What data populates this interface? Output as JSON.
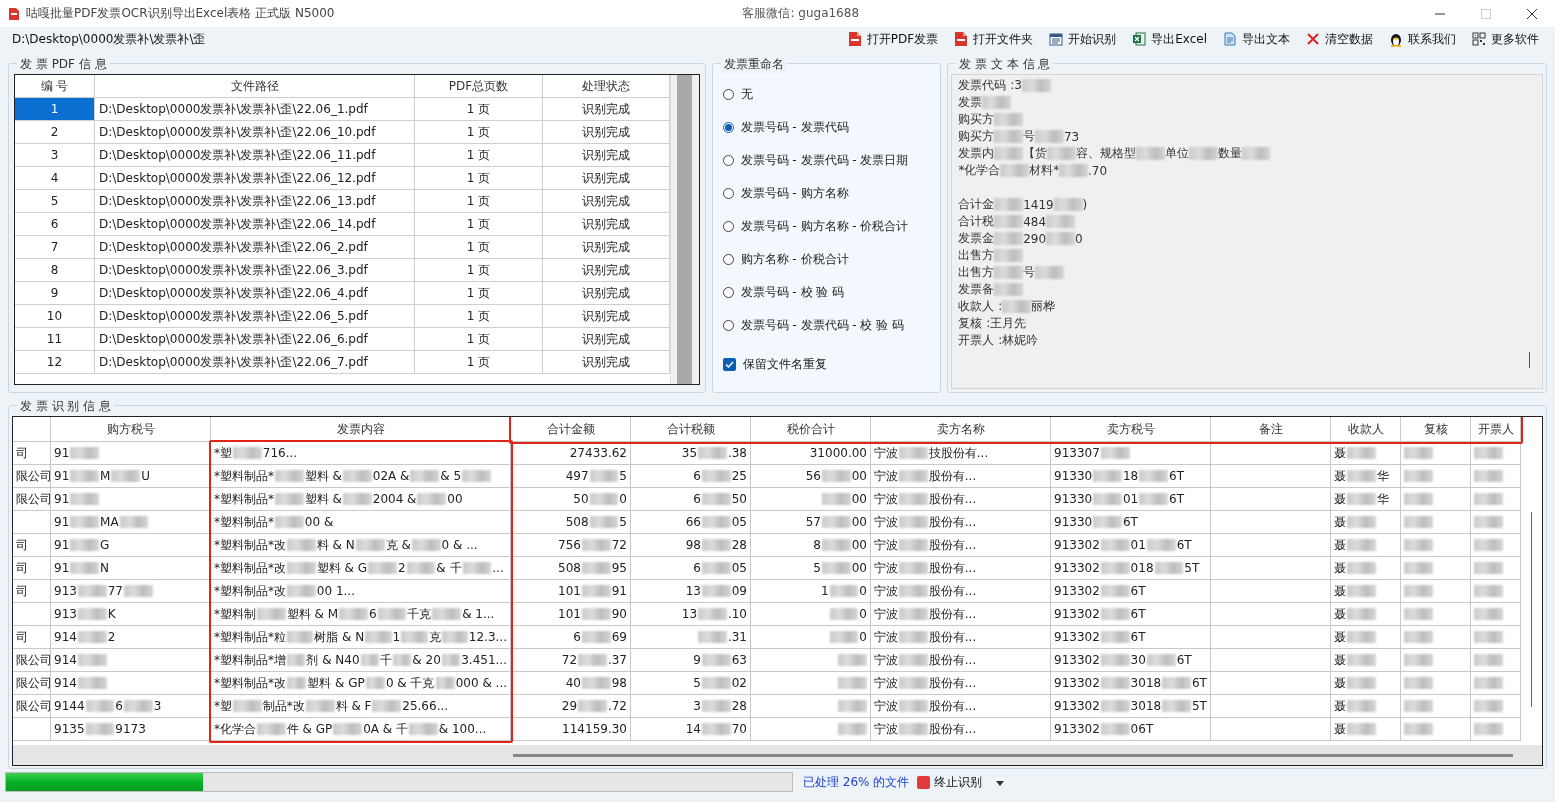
{
  "window": {
    "title": "咕嘎批量PDF发票OCR识别导出Excel表格  正式版 N5000",
    "contact": "客服微信: guga1688"
  },
  "path_field": {
    "value": "D:\\Desktop\\0000发票补\\发票补\\歪"
  },
  "toolbar": [
    {
      "label": "打开PDF发票"
    },
    {
      "label": "打开文件夹"
    },
    {
      "label": "开始识别"
    },
    {
      "label": "导出Excel"
    },
    {
      "label": "导出文本"
    },
    {
      "label": "清空数据"
    },
    {
      "label": "联系我们"
    },
    {
      "label": "更多软件"
    }
  ],
  "pdf_info": {
    "title": "发 票 PDF 信 息",
    "columns": [
      "编 号",
      "文件路径",
      "PDF总页数",
      "处理状态"
    ],
    "rows": [
      {
        "selected": true,
        "cells": [
          "1",
          "D:\\Desktop\\0000发票补\\发票补\\歪\\22.06_1.pdf",
          "1 页",
          "识别完成"
        ]
      },
      {
        "selected": false,
        "cells": [
          "2",
          "D:\\Desktop\\0000发票补\\发票补\\歪\\22.06_10.pdf",
          "1 页",
          "识别完成"
        ]
      },
      {
        "selected": false,
        "cells": [
          "3",
          "D:\\Desktop\\0000发票补\\发票补\\歪\\22.06_11.pdf",
          "1 页",
          "识别完成"
        ]
      },
      {
        "selected": false,
        "cells": [
          "4",
          "D:\\Desktop\\0000发票补\\发票补\\歪\\22.06_12.pdf",
          "1 页",
          "识别完成"
        ]
      },
      {
        "selected": false,
        "cells": [
          "5",
          "D:\\Desktop\\0000发票补\\发票补\\歪\\22.06_13.pdf",
          "1 页",
          "识别完成"
        ]
      },
      {
        "selected": false,
        "cells": [
          "6",
          "D:\\Desktop\\0000发票补\\发票补\\歪\\22.06_14.pdf",
          "1 页",
          "识别完成"
        ]
      },
      {
        "selected": false,
        "cells": [
          "7",
          "D:\\Desktop\\0000发票补\\发票补\\歪\\22.06_2.pdf",
          "1 页",
          "识别完成"
        ]
      },
      {
        "selected": false,
        "cells": [
          "8",
          "D:\\Desktop\\0000发票补\\发票补\\歪\\22.06_3.pdf",
          "1 页",
          "识别完成"
        ]
      },
      {
        "selected": false,
        "cells": [
          "9",
          "D:\\Desktop\\0000发票补\\发票补\\歪\\22.06_4.pdf",
          "1 页",
          "识别完成"
        ]
      },
      {
        "selected": false,
        "cells": [
          "10",
          "D:\\Desktop\\0000发票补\\发票补\\歪\\22.06_5.pdf",
          "1 页",
          "识别完成"
        ]
      },
      {
        "selected": false,
        "cells": [
          "11",
          "D:\\Desktop\\0000发票补\\发票补\\歪\\22.06_6.pdf",
          "1 页",
          "识别完成"
        ]
      },
      {
        "selected": false,
        "cells": [
          "12",
          "D:\\Desktop\\0000发票补\\发票补\\歪\\22.06_7.pdf",
          "1 页",
          "识别完成"
        ]
      }
    ]
  },
  "rename": {
    "title": "发票重命名",
    "options": [
      {
        "label": "无",
        "selected": false
      },
      {
        "label": "发票号码 - 发票代码",
        "selected": true
      },
      {
        "label": "发票号码 - 发票代码 - 发票日期",
        "selected": false
      },
      {
        "label": "发票号码 - 购方名称",
        "selected": false
      },
      {
        "label": "发票号码 - 购方名称 - 价税合计",
        "selected": false
      },
      {
        "label": "购方名称 - 价税合计",
        "selected": false
      },
      {
        "label": "发票号码 - 校 验 码",
        "selected": false
      },
      {
        "label": "发票号码 - 发票代码 - 校 验 码",
        "selected": false
      }
    ],
    "keep_duplicates": {
      "label": "保留文件名重复",
      "checked": true
    }
  },
  "text_info": {
    "title": "发 票 文 本 信 息",
    "lines": [
      {
        "kind": "text",
        "parts": [
          {
            "kind": "text",
            "text": "发票代码 :3"
          },
          {
            "kind": "blur"
          }
        ]
      },
      {
        "kind": "text",
        "parts": [
          {
            "kind": "text",
            "text": "发票"
          },
          {
            "kind": "blur"
          }
        ]
      },
      {
        "kind": "text",
        "parts": [
          {
            "kind": "text",
            "text": "购买方"
          },
          {
            "kind": "blur"
          }
        ]
      },
      {
        "kind": "text",
        "parts": [
          {
            "kind": "text",
            "text": "购买方"
          },
          {
            "kind": "blur"
          },
          {
            "kind": "text",
            "text": "号"
          },
          {
            "kind": "blur"
          },
          {
            "kind": "text",
            "text": "73"
          }
        ]
      },
      {
        "kind": "text",
        "parts": [
          {
            "kind": "text",
            "text": "发票内"
          },
          {
            "kind": "blur"
          },
          {
            "kind": "text",
            "text": "【货"
          },
          {
            "kind": "blur"
          },
          {
            "kind": "text",
            "text": "容、规格型"
          },
          {
            "kind": "blur"
          },
          {
            "kind": "text",
            "text": "单位"
          },
          {
            "kind": "blur"
          },
          {
            "kind": "text",
            "text": "数量"
          },
          {
            "kind": "blur"
          }
        ]
      },
      {
        "kind": "text",
        "parts": [
          {
            "kind": "text",
            "text": "*化学合"
          },
          {
            "kind": "blur"
          },
          {
            "kind": "text",
            "text": "材料*"
          },
          {
            "kind": "blur"
          },
          {
            "kind": "text",
            "text": ".70"
          }
        ]
      },
      {
        "kind": "blank"
      },
      {
        "kind": "text",
        "parts": [
          {
            "kind": "text",
            "text": "合计金"
          },
          {
            "kind": "blur"
          },
          {
            "kind": "text",
            "text": "1419"
          },
          {
            "kind": "blur"
          },
          {
            "kind": "text",
            "text": ")"
          }
        ]
      },
      {
        "kind": "text",
        "parts": [
          {
            "kind": "text",
            "text": "合计税"
          },
          {
            "kind": "blur"
          },
          {
            "kind": "text",
            "text": "484"
          },
          {
            "kind": "blur"
          }
        ]
      },
      {
        "kind": "text",
        "parts": [
          {
            "kind": "text",
            "text": "发票金"
          },
          {
            "kind": "blur"
          },
          {
            "kind": "text",
            "text": "290"
          },
          {
            "kind": "blur"
          },
          {
            "kind": "text",
            "text": "0"
          }
        ]
      },
      {
        "kind": "text",
        "parts": [
          {
            "kind": "text",
            "text": "出售方"
          },
          {
            "kind": "blur"
          }
        ]
      },
      {
        "kind": "text",
        "parts": [
          {
            "kind": "text",
            "text": "出售方"
          },
          {
            "kind": "blur"
          },
          {
            "kind": "text",
            "text": "号"
          },
          {
            "kind": "blur"
          }
        ]
      },
      {
        "kind": "text",
        "parts": [
          {
            "kind": "text",
            "text": "发票备"
          },
          {
            "kind": "blur"
          }
        ]
      },
      {
        "kind": "text",
        "parts": [
          {
            "kind": "text",
            "text": "收款人 :"
          },
          {
            "kind": "blur"
          },
          {
            "kind": "text",
            "text": "丽桦"
          }
        ]
      },
      {
        "kind": "text",
        "parts": [
          {
            "kind": "text",
            "text": "复核 :王月先"
          }
        ]
      },
      {
        "kind": "text",
        "parts": [
          {
            "kind": "text",
            "text": "开票人 :林妮吟"
          }
        ]
      }
    ]
  },
  "results": {
    "title": "发 票 识 别 信 息",
    "columns": [
      {
        "header_marked": false,
        "body_marked": false
      },
      {
        "label": "购方税号",
        "header_marked": false,
        "body_marked": false
      },
      {
        "label": "发票内容",
        "header_marked": false,
        "body_marked": true
      },
      {
        "label": "合计金额",
        "header_marked": true,
        "body_marked": false
      },
      {
        "label": "合计税额",
        "header_marked": true,
        "body_marked": false
      },
      {
        "label": "税价合计",
        "header_marked": true,
        "body_marked": false
      },
      {
        "label": "卖方名称",
        "header_marked": true,
        "body_marked": false
      },
      {
        "label": "卖方税号",
        "header_marked": true,
        "body_marked": false
      },
      {
        "label": "备注",
        "header_marked": true,
        "body_marked": false
      },
      {
        "label": "收款人",
        "header_marked": true,
        "body_marked": false
      },
      {
        "label": "复核",
        "header_marked": true,
        "body_marked": false
      },
      {
        "label": "开票人",
        "header_marked": true,
        "body_marked": false
      }
    ],
    "rows": [
      [
        [
          {
            "kind": "text",
            "text": "司"
          }
        ],
        [
          {
            "kind": "text",
            "text": "91"
          },
          {
            "kind": "blur"
          }
        ],
        [
          {
            "kind": "text",
            "text": "*塑"
          },
          {
            "kind": "blur"
          },
          {
            "kind": "text",
            "text": "716..."
          }
        ],
        [
          {
            "kind": "text",
            "text": "27433.62"
          }
        ],
        [
          {
            "kind": "text",
            "text": "35"
          },
          {
            "kind": "blur"
          },
          {
            "kind": "text",
            "text": ".38"
          }
        ],
        [
          {
            "kind": "text",
            "text": "31000.00"
          }
        ],
        [
          {
            "kind": "text",
            "text": "宁波"
          },
          {
            "kind": "blur"
          },
          {
            "kind": "text",
            "text": "技股份有..."
          }
        ],
        [
          {
            "kind": "text",
            "text": "913307"
          },
          {
            "kind": "blur"
          }
        ],
        "",
        [
          {
            "kind": "text",
            "text": "聂"
          },
          {
            "kind": "blur"
          }
        ],
        [
          {
            "kind": "blur"
          }
        ],
        [
          {
            "kind": "blur"
          }
        ]
      ],
      [
        [
          {
            "kind": "text",
            "text": "限公司"
          }
        ],
        [
          {
            "kind": "text",
            "text": "91"
          },
          {
            "kind": "blur"
          },
          {
            "kind": "text",
            "text": "M"
          },
          {
            "kind": "blur"
          },
          {
            "kind": "text",
            "text": "U"
          }
        ],
        [
          {
            "kind": "text",
            "text": "*塑料制品*"
          },
          {
            "kind": "blur"
          },
          {
            "kind": "text",
            "text": "塑料 & "
          },
          {
            "kind": "blur"
          },
          {
            "kind": "text",
            "text": "02A & "
          },
          {
            "kind": "blur"
          },
          {
            "kind": "text",
            "text": " & 5"
          },
          {
            "kind": "blur"
          }
        ],
        [
          {
            "kind": "text",
            "text": "497"
          },
          {
            "kind": "blur"
          },
          {
            "kind": "text",
            "text": "5"
          }
        ],
        [
          {
            "kind": "text",
            "text": "6"
          },
          {
            "kind": "blur"
          },
          {
            "kind": "text",
            "text": "25"
          }
        ],
        [
          {
            "kind": "text",
            "text": "56"
          },
          {
            "kind": "blur"
          },
          {
            "kind": "text",
            "text": "00"
          }
        ],
        [
          {
            "kind": "text",
            "text": "宁波"
          },
          {
            "kind": "blur"
          },
          {
            "kind": "text",
            "text": "股份有..."
          }
        ],
        [
          {
            "kind": "text",
            "text": "91330"
          },
          {
            "kind": "blur"
          },
          {
            "kind": "text",
            "text": "18"
          },
          {
            "kind": "blur"
          },
          {
            "kind": "text",
            "text": "6T"
          }
        ],
        "",
        [
          {
            "kind": "text",
            "text": "聂"
          },
          {
            "kind": "blur"
          },
          {
            "kind": "text",
            "text": "华"
          }
        ],
        [
          {
            "kind": "blur"
          }
        ],
        [
          {
            "kind": "blur"
          }
        ]
      ],
      [
        [
          {
            "kind": "text",
            "text": "限公司"
          }
        ],
        [
          {
            "kind": "text",
            "text": "91"
          },
          {
            "kind": "blur"
          }
        ],
        [
          {
            "kind": "text",
            "text": "*塑料制品*"
          },
          {
            "kind": "blur"
          },
          {
            "kind": "text",
            "text": "塑料 & "
          },
          {
            "kind": "blur"
          },
          {
            "kind": "text",
            "text": "2004 & "
          },
          {
            "kind": "blur"
          },
          {
            "kind": "text",
            "text": "00"
          }
        ],
        [
          {
            "kind": "text",
            "text": "50"
          },
          {
            "kind": "blur"
          },
          {
            "kind": "text",
            "text": "0"
          }
        ],
        [
          {
            "kind": "text",
            "text": "6"
          },
          {
            "kind": "blur"
          },
          {
            "kind": "text",
            "text": "50"
          }
        ],
        [
          {
            "kind": "blur"
          },
          {
            "kind": "text",
            "text": "00"
          }
        ],
        [
          {
            "kind": "text",
            "text": "宁波"
          },
          {
            "kind": "blur"
          },
          {
            "kind": "text",
            "text": "股份有..."
          }
        ],
        [
          {
            "kind": "text",
            "text": "91330"
          },
          {
            "kind": "blur"
          },
          {
            "kind": "text",
            "text": "01"
          },
          {
            "kind": "blur"
          },
          {
            "kind": "text",
            "text": "6T"
          }
        ],
        "",
        [
          {
            "kind": "text",
            "text": "聂"
          },
          {
            "kind": "blur"
          },
          {
            "kind": "text",
            "text": "华"
          }
        ],
        [
          {
            "kind": "blur"
          }
        ],
        [
          {
            "kind": "blur"
          }
        ]
      ],
      [
        "",
        [
          {
            "kind": "text",
            "text": "91"
          },
          {
            "kind": "blur"
          },
          {
            "kind": "text",
            "text": "MA"
          },
          {
            "kind": "blur"
          }
        ],
        [
          {
            "kind": "text",
            "text": "*塑料制品*"
          },
          {
            "kind": "blur"
          },
          {
            "kind": "text",
            "text": "00 &"
          }
        ],
        [
          {
            "kind": "text",
            "text": "508"
          },
          {
            "kind": "blur"
          },
          {
            "kind": "text",
            "text": "5"
          }
        ],
        [
          {
            "kind": "text",
            "text": "66"
          },
          {
            "kind": "blur"
          },
          {
            "kind": "text",
            "text": "05"
          }
        ],
        [
          {
            "kind": "text",
            "text": "57"
          },
          {
            "kind": "blur"
          },
          {
            "kind": "text",
            "text": "00"
          }
        ],
        [
          {
            "kind": "text",
            "text": "宁波"
          },
          {
            "kind": "blur"
          },
          {
            "kind": "text",
            "text": "股份有..."
          }
        ],
        [
          {
            "kind": "text",
            "text": "91330"
          },
          {
            "kind": "blur"
          },
          {
            "kind": "text",
            "text": "6T"
          }
        ],
        "",
        [
          {
            "kind": "text",
            "text": "聂"
          },
          {
            "kind": "blur"
          }
        ],
        [
          {
            "kind": "blur"
          }
        ],
        [
          {
            "kind": "blur"
          }
        ]
      ],
      [
        [
          {
            "kind": "text",
            "text": "司"
          }
        ],
        [
          {
            "kind": "text",
            "text": "91"
          },
          {
            "kind": "blur"
          },
          {
            "kind": "text",
            "text": "G"
          }
        ],
        [
          {
            "kind": "text",
            "text": "*塑料制品*改"
          },
          {
            "kind": "blur"
          },
          {
            "kind": "text",
            "text": "料 & N"
          },
          {
            "kind": "blur"
          },
          {
            "kind": "text",
            "text": "克 & "
          },
          {
            "kind": "blur"
          },
          {
            "kind": "text",
            "text": "0 & ..."
          }
        ],
        [
          {
            "kind": "text",
            "text": "756"
          },
          {
            "kind": "blur"
          },
          {
            "kind": "text",
            "text": "72"
          }
        ],
        [
          {
            "kind": "text",
            "text": "98"
          },
          {
            "kind": "blur"
          },
          {
            "kind": "text",
            "text": "28"
          }
        ],
        [
          {
            "kind": "text",
            "text": "8"
          },
          {
            "kind": "blur"
          },
          {
            "kind": "text",
            "text": "00"
          }
        ],
        [
          {
            "kind": "text",
            "text": "宁波"
          },
          {
            "kind": "blur"
          },
          {
            "kind": "text",
            "text": "股份有..."
          }
        ],
        [
          {
            "kind": "text",
            "text": "913302"
          },
          {
            "kind": "blur"
          },
          {
            "kind": "text",
            "text": "01"
          },
          {
            "kind": "blur"
          },
          {
            "kind": "text",
            "text": "6T"
          }
        ],
        "",
        [
          {
            "kind": "text",
            "text": "聂"
          },
          {
            "kind": "blur"
          }
        ],
        [
          {
            "kind": "blur"
          }
        ],
        [
          {
            "kind": "blur"
          }
        ]
      ],
      [
        [
          {
            "kind": "text",
            "text": "司"
          }
        ],
        [
          {
            "kind": "text",
            "text": "91"
          },
          {
            "kind": "blur"
          },
          {
            "kind": "text",
            "text": "N"
          }
        ],
        [
          {
            "kind": "text",
            "text": "*塑料制品*改"
          },
          {
            "kind": "blur"
          },
          {
            "kind": "text",
            "text": "塑料 & G"
          },
          {
            "kind": "blur"
          },
          {
            "kind": "text",
            "text": "2"
          },
          {
            "kind": "blur"
          },
          {
            "kind": "text",
            "text": "& 千"
          },
          {
            "kind": "blur"
          },
          {
            "kind": "text",
            "text": "..."
          }
        ],
        [
          {
            "kind": "text",
            "text": "508"
          },
          {
            "kind": "blur"
          },
          {
            "kind": "text",
            "text": "95"
          }
        ],
        [
          {
            "kind": "text",
            "text": "6"
          },
          {
            "kind": "blur"
          },
          {
            "kind": "text",
            "text": "05"
          }
        ],
        [
          {
            "kind": "text",
            "text": "5"
          },
          {
            "kind": "blur"
          },
          {
            "kind": "text",
            "text": "00"
          }
        ],
        [
          {
            "kind": "text",
            "text": "宁波"
          },
          {
            "kind": "blur"
          },
          {
            "kind": "text",
            "text": "股份有..."
          }
        ],
        [
          {
            "kind": "text",
            "text": "913302"
          },
          {
            "kind": "blur"
          },
          {
            "kind": "text",
            "text": "018"
          },
          {
            "kind": "blur"
          },
          {
            "kind": "text",
            "text": "5T"
          }
        ],
        "",
        [
          {
            "kind": "text",
            "text": "聂"
          },
          {
            "kind": "blur"
          }
        ],
        [
          {
            "kind": "blur"
          }
        ],
        [
          {
            "kind": "blur"
          }
        ]
      ],
      [
        [
          {
            "kind": "text",
            "text": "司"
          }
        ],
        [
          {
            "kind": "text",
            "text": "913"
          },
          {
            "kind": "blur"
          },
          {
            "kind": "text",
            "text": "77"
          },
          {
            "kind": "blur"
          }
        ],
        [
          {
            "kind": "text",
            "text": "*塑料制品*改"
          },
          {
            "kind": "blur"
          },
          {
            "kind": "text",
            "text": "00 1..."
          }
        ],
        [
          {
            "kind": "text",
            "text": "101"
          },
          {
            "kind": "blur"
          },
          {
            "kind": "text",
            "text": "91"
          }
        ],
        [
          {
            "kind": "text",
            "text": "13"
          },
          {
            "kind": "blur"
          },
          {
            "kind": "text",
            "text": "09"
          }
        ],
        [
          {
            "kind": "text",
            "text": "1"
          },
          {
            "kind": "blur"
          },
          {
            "kind": "text",
            "text": "0"
          }
        ],
        [
          {
            "kind": "text",
            "text": "宁波"
          },
          {
            "kind": "blur"
          },
          {
            "kind": "text",
            "text": "股份有..."
          }
        ],
        [
          {
            "kind": "text",
            "text": "913302"
          },
          {
            "kind": "blur"
          },
          {
            "kind": "text",
            "text": "6T"
          }
        ],
        "",
        [
          {
            "kind": "text",
            "text": "聂"
          },
          {
            "kind": "blur"
          }
        ],
        [
          {
            "kind": "blur"
          }
        ],
        [
          {
            "kind": "blur"
          }
        ]
      ],
      [
        "",
        [
          {
            "kind": "text",
            "text": "913"
          },
          {
            "kind": "blur"
          },
          {
            "kind": "text",
            "text": "K"
          }
        ],
        [
          {
            "kind": "text",
            "text": "*塑料制"
          },
          {
            "kind": "blur"
          },
          {
            "kind": "text",
            "text": "塑料 & M"
          },
          {
            "kind": "blur"
          },
          {
            "kind": "text",
            "text": "6"
          },
          {
            "kind": "blur"
          },
          {
            "kind": "text",
            "text": "千克"
          },
          {
            "kind": "blur"
          },
          {
            "kind": "text",
            "text": "& 1..."
          }
        ],
        [
          {
            "kind": "text",
            "text": "101"
          },
          {
            "kind": "blur"
          },
          {
            "kind": "text",
            "text": "90"
          }
        ],
        [
          {
            "kind": "text",
            "text": "13"
          },
          {
            "kind": "blur"
          },
          {
            "kind": "text",
            "text": ".10"
          }
        ],
        [
          {
            "kind": "blur"
          },
          {
            "kind": "text",
            "text": "0"
          }
        ],
        [
          {
            "kind": "text",
            "text": "宁波"
          },
          {
            "kind": "blur"
          },
          {
            "kind": "text",
            "text": "股份有..."
          }
        ],
        [
          {
            "kind": "text",
            "text": "913302"
          },
          {
            "kind": "blur"
          },
          {
            "kind": "text",
            "text": "6T"
          }
        ],
        "",
        [
          {
            "kind": "text",
            "text": "聂"
          },
          {
            "kind": "blur"
          }
        ],
        [
          {
            "kind": "blur"
          }
        ],
        [
          {
            "kind": "blur"
          }
        ]
      ],
      [
        [
          {
            "kind": "text",
            "text": "司"
          }
        ],
        [
          {
            "kind": "text",
            "text": "914"
          },
          {
            "kind": "blur"
          },
          {
            "kind": "text",
            "text": "2"
          }
        ],
        [
          {
            "kind": "text",
            "text": "*塑料制品*粒"
          },
          {
            "kind": "blur"
          },
          {
            "kind": "text",
            "text": "树脂 & N"
          },
          {
            "kind": "blur"
          },
          {
            "kind": "text",
            "text": "1"
          },
          {
            "kind": "blur"
          },
          {
            "kind": "text",
            "text": "克"
          },
          {
            "kind": "blur"
          },
          {
            "kind": "text",
            "text": "12.3..."
          }
        ],
        [
          {
            "kind": "text",
            "text": "6"
          },
          {
            "kind": "blur"
          },
          {
            "kind": "text",
            "text": "69"
          }
        ],
        [
          {
            "kind": "blur"
          },
          {
            "kind": "text",
            "text": ".31"
          }
        ],
        [
          {
            "kind": "blur"
          },
          {
            "kind": "text",
            "text": "0"
          }
        ],
        [
          {
            "kind": "text",
            "text": "宁波"
          },
          {
            "kind": "blur"
          },
          {
            "kind": "text",
            "text": "股份有..."
          }
        ],
        [
          {
            "kind": "text",
            "text": "913302"
          },
          {
            "kind": "blur"
          },
          {
            "kind": "text",
            "text": "6T"
          }
        ],
        "",
        [
          {
            "kind": "text",
            "text": "聂"
          },
          {
            "kind": "blur"
          }
        ],
        [
          {
            "kind": "blur"
          }
        ],
        [
          {
            "kind": "blur"
          }
        ]
      ],
      [
        [
          {
            "kind": "text",
            "text": "限公司"
          }
        ],
        [
          {
            "kind": "text",
            "text": "914"
          },
          {
            "kind": "blur"
          }
        ],
        [
          {
            "kind": "text",
            "text": "*塑料制品*增"
          },
          {
            "kind": "blur"
          },
          {
            "kind": "text",
            "text": "剂 & N40"
          },
          {
            "kind": "blur"
          },
          {
            "kind": "text",
            "text": "千"
          },
          {
            "kind": "blur"
          },
          {
            "kind": "text",
            "text": "& 20"
          },
          {
            "kind": "blur"
          },
          {
            "kind": "text",
            "text": "3.451..."
          }
        ],
        [
          {
            "kind": "text",
            "text": "72"
          },
          {
            "kind": "blur"
          },
          {
            "kind": "text",
            "text": ".37"
          }
        ],
        [
          {
            "kind": "text",
            "text": "9"
          },
          {
            "kind": "blur"
          },
          {
            "kind": "text",
            "text": "63"
          }
        ],
        [
          {
            "kind": "blur"
          }
        ],
        [
          {
            "kind": "text",
            "text": "宁波"
          },
          {
            "kind": "blur"
          },
          {
            "kind": "text",
            "text": "股份有..."
          }
        ],
        [
          {
            "kind": "text",
            "text": "913302"
          },
          {
            "kind": "blur"
          },
          {
            "kind": "text",
            "text": "30"
          },
          {
            "kind": "blur"
          },
          {
            "kind": "text",
            "text": "6T"
          }
        ],
        "",
        [
          {
            "kind": "text",
            "text": "聂"
          },
          {
            "kind": "blur"
          }
        ],
        [
          {
            "kind": "blur"
          }
        ],
        [
          {
            "kind": "blur"
          }
        ]
      ],
      [
        [
          {
            "kind": "text",
            "text": "限公司"
          }
        ],
        [
          {
            "kind": "text",
            "text": "914"
          },
          {
            "kind": "blur"
          }
        ],
        [
          {
            "kind": "text",
            "text": "*塑料制品*改"
          },
          {
            "kind": "blur"
          },
          {
            "kind": "text",
            "text": "塑料 & GP"
          },
          {
            "kind": "blur"
          },
          {
            "kind": "text",
            "text": "0 & 千克"
          },
          {
            "kind": "blur"
          },
          {
            "kind": "text",
            "text": "000 & ..."
          }
        ],
        [
          {
            "kind": "text",
            "text": "40"
          },
          {
            "kind": "blur"
          },
          {
            "kind": "text",
            "text": "98"
          }
        ],
        [
          {
            "kind": "text",
            "text": "5"
          },
          {
            "kind": "blur"
          },
          {
            "kind": "text",
            "text": "02"
          }
        ],
        [
          {
            "kind": "blur"
          }
        ],
        [
          {
            "kind": "text",
            "text": "宁波"
          },
          {
            "kind": "blur"
          },
          {
            "kind": "text",
            "text": "股份有..."
          }
        ],
        [
          {
            "kind": "text",
            "text": "913302"
          },
          {
            "kind": "blur"
          },
          {
            "kind": "text",
            "text": "3018"
          },
          {
            "kind": "blur"
          },
          {
            "kind": "text",
            "text": "6T"
          }
        ],
        "",
        [
          {
            "kind": "text",
            "text": "聂"
          },
          {
            "kind": "blur"
          }
        ],
        [
          {
            "kind": "blur"
          }
        ],
        [
          {
            "kind": "blur"
          }
        ]
      ],
      [
        [
          {
            "kind": "text",
            "text": "限公司"
          }
        ],
        [
          {
            "kind": "text",
            "text": "9144"
          },
          {
            "kind": "blur"
          },
          {
            "kind": "text",
            "text": "6"
          },
          {
            "kind": "blur"
          },
          {
            "kind": "text",
            "text": "3"
          }
        ],
        [
          {
            "kind": "text",
            "text": "*塑"
          },
          {
            "kind": "blur"
          },
          {
            "kind": "text",
            "text": "制品*改"
          },
          {
            "kind": "blur"
          },
          {
            "kind": "text",
            "text": "料 & F"
          },
          {
            "kind": "blur"
          },
          {
            "kind": "text",
            "text": "25.66..."
          }
        ],
        [
          {
            "kind": "text",
            "text": "29"
          },
          {
            "kind": "blur"
          },
          {
            "kind": "text",
            "text": ".72"
          }
        ],
        [
          {
            "kind": "text",
            "text": "3"
          },
          {
            "kind": "blur"
          },
          {
            "kind": "text",
            "text": "28"
          }
        ],
        [
          {
            "kind": "blur"
          }
        ],
        [
          {
            "kind": "text",
            "text": "宁波"
          },
          {
            "kind": "blur"
          },
          {
            "kind": "text",
            "text": "股份有..."
          }
        ],
        [
          {
            "kind": "text",
            "text": "913302"
          },
          {
            "kind": "blur"
          },
          {
            "kind": "text",
            "text": "3018"
          },
          {
            "kind": "blur"
          },
          {
            "kind": "text",
            "text": "5T"
          }
        ],
        "",
        [
          {
            "kind": "text",
            "text": "聂"
          },
          {
            "kind": "blur"
          }
        ],
        [
          {
            "kind": "blur"
          }
        ],
        [
          {
            "kind": "blur"
          }
        ]
      ],
      [
        "",
        [
          {
            "kind": "text",
            "text": "9135"
          },
          {
            "kind": "blur"
          },
          {
            "kind": "text",
            "text": "9173"
          }
        ],
        [
          {
            "kind": "text",
            "text": "*化学合"
          },
          {
            "kind": "blur"
          },
          {
            "kind": "text",
            "text": "件 & GP"
          },
          {
            "kind": "blur"
          },
          {
            "kind": "text",
            "text": "0A & 千"
          },
          {
            "kind": "blur"
          },
          {
            "kind": "text",
            "text": "& 100..."
          }
        ],
        [
          {
            "kind": "text",
            "text": "114159.30"
          }
        ],
        [
          {
            "kind": "text",
            "text": "14"
          },
          {
            "kind": "blur"
          },
          {
            "kind": "text",
            "text": "70"
          }
        ],
        [
          {
            "kind": "blur"
          }
        ],
        [
          {
            "kind": "text",
            "text": "宁波"
          },
          {
            "kind": "blur"
          },
          {
            "kind": "text",
            "text": "股份有..."
          }
        ],
        [
          {
            "kind": "text",
            "text": "913302"
          },
          {
            "kind": "blur"
          },
          {
            "kind": "text",
            "text": "06T"
          }
        ],
        "",
        [
          {
            "kind": "text",
            "text": "聂"
          },
          {
            "kind": "blur"
          }
        ],
        [
          {
            "kind": "blur"
          }
        ],
        [
          {
            "kind": "blur"
          }
        ]
      ]
    ]
  },
  "status_bar": {
    "level": 0.25,
    "message": "已处理 26% 的文件",
    "stop_button": "终止识别"
  }
}
